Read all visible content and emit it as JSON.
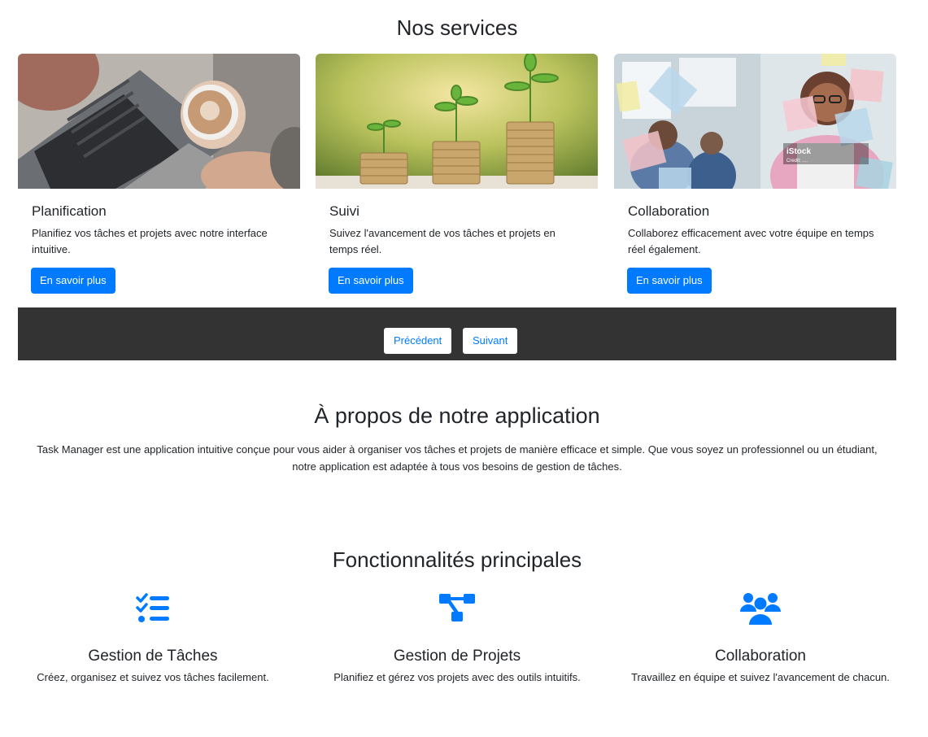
{
  "services": {
    "title": "Nos services",
    "cards": [
      {
        "title": "Planification",
        "text": "Planifiez vos tâches et projets avec notre interface intuitive.",
        "button": "En savoir plus",
        "image": "laptop-coffee-photo"
      },
      {
        "title": "Suivi",
        "text": "Suivez l'avancement de vos tâches et projets en temps réel.",
        "button": "En savoir plus",
        "image": "coins-plants-photo"
      },
      {
        "title": "Collaboration",
        "text": "Collaborez efficacement avec votre équipe en temps réel également.",
        "button": "En savoir plus",
        "image": "team-sticky-notes-photo",
        "watermark": "iStock",
        "credit": "Credit: ...."
      }
    ],
    "carousel": {
      "prev": "Précédent",
      "next": "Suivant"
    }
  },
  "about": {
    "title": "À propos de notre application",
    "text": "Task Manager est une application intuitive conçue pour vous aider à organiser vos tâches et projets de manière efficace et simple. Que vous soyez un professionnel ou un étudiant, notre application est adaptée à tous vos besoins de gestion de tâches."
  },
  "features": {
    "title": "Fonctionnalités principales",
    "items": [
      {
        "icon": "task-list-icon",
        "title": "Gestion de Tâches",
        "text": "Créez, organisez et suivez vos tâches facilement."
      },
      {
        "icon": "project-diagram-icon",
        "title": "Gestion de Projets",
        "text": "Planifiez et gérez vos projets avec des outils intuitifs."
      },
      {
        "icon": "users-group-icon",
        "title": "Collaboration",
        "text": "Travaillez en équipe et suivez l'avancement de chacun."
      }
    ]
  },
  "colors": {
    "primary": "#007bff",
    "carousel_bg": "#333333",
    "text": "#212529"
  }
}
